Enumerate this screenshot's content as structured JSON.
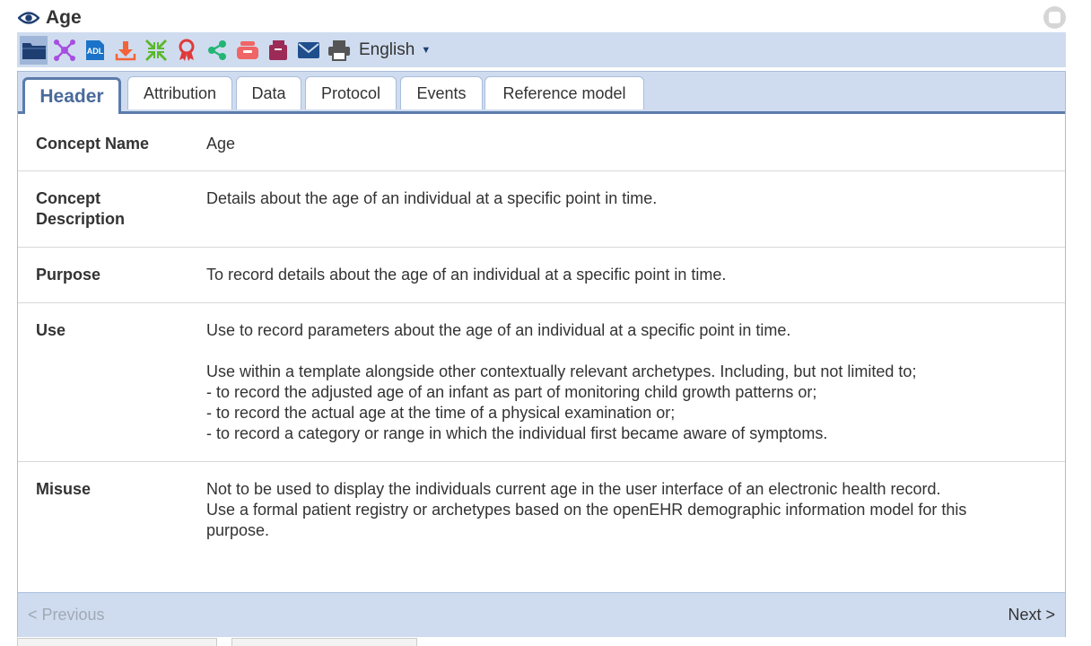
{
  "window": {
    "title": "Age"
  },
  "toolbar": {
    "icons": [
      "folder-icon",
      "mindmap-icon",
      "adl-icon",
      "download-icon",
      "compress-icon",
      "ribbon-icon",
      "share-icon",
      "inbox-icon",
      "archive-icon",
      "mail-icon",
      "print-icon"
    ],
    "adl_text": "ADL",
    "language": "English"
  },
  "tabs": [
    {
      "label": "Header",
      "active": true
    },
    {
      "label": "Attribution",
      "active": false
    },
    {
      "label": "Data",
      "active": false
    },
    {
      "label": "Protocol",
      "active": false
    },
    {
      "label": "Events",
      "active": false
    },
    {
      "label": "Reference model",
      "active": false
    }
  ],
  "header": {
    "concept_name": {
      "label": "Concept Name",
      "value": "Age"
    },
    "concept_description": {
      "label": "Concept Description",
      "value": "Details about the age of an individual at a specific point in time."
    },
    "purpose": {
      "label": "Purpose",
      "value": "To record details about the age of an individual at a specific point in time."
    },
    "use": {
      "label": "Use",
      "lines": [
        "Use to record parameters about the age of an individual at a specific point in time.",
        "",
        "Use within a template alongside other contextually relevant archetypes. Including, but not limited to;",
        "- to record the adjusted age of an infant as part of monitoring child growth patterns or;",
        "- to record the actual age at the time of a physical examination or;",
        "- to record a category or range in which the individual first became aware of symptoms."
      ]
    },
    "misuse": {
      "label": "Misuse",
      "lines": [
        "Not to be used to display the individuals current age in the user interface of an electronic health record.",
        "Use a formal patient registry or archetypes based on the openEHR demographic information model for this purpose."
      ]
    }
  },
  "footer": {
    "previous": "< Previous",
    "next": "Next >"
  },
  "colors": {
    "toolbar_bg": "#cfdcef",
    "accent": "#5b7bab",
    "active_tab_text": "#4a6a9c"
  }
}
